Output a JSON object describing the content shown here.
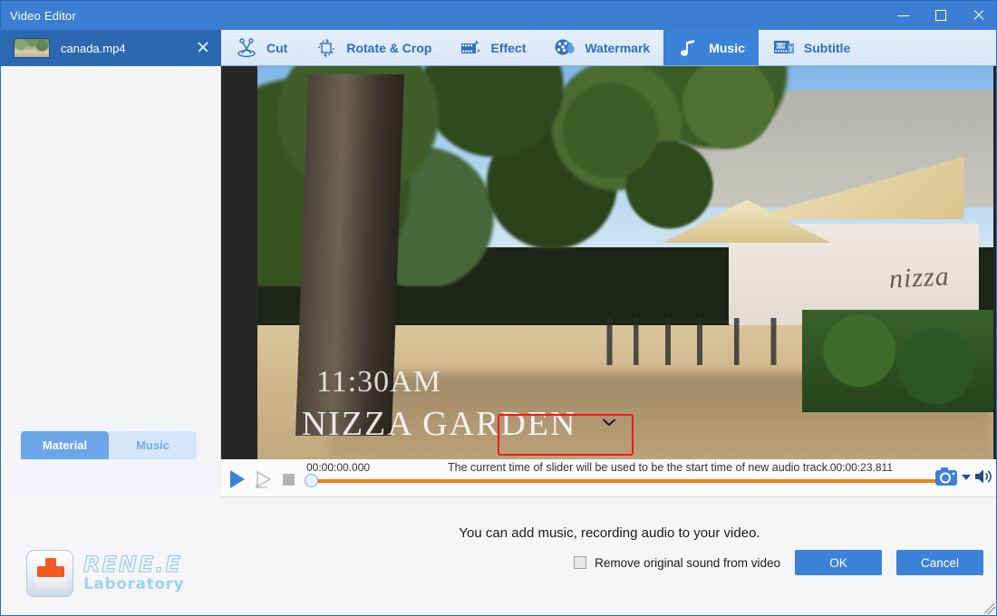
{
  "window": {
    "title": "Video Editor",
    "minimize_label": "Minimize",
    "maximize_label": "Maximize",
    "close_label": "Close"
  },
  "file_tab": {
    "name": "canada.mp4",
    "close_label": "Close file"
  },
  "toolbar": {
    "items": [
      {
        "label": "Cut",
        "icon": "scissors-icon",
        "active": false
      },
      {
        "label": "Rotate & Crop",
        "icon": "crop-rotate-icon",
        "active": false
      },
      {
        "label": "Effect",
        "icon": "film-sparkle-icon",
        "active": false
      },
      {
        "label": "Watermark",
        "icon": "watermark-icon",
        "active": false
      },
      {
        "label": "Music",
        "icon": "music-note-icon",
        "active": true
      },
      {
        "label": "Subtitle",
        "icon": "subtitle-icon",
        "active": false
      }
    ]
  },
  "left_panel": {
    "tabs": [
      {
        "label": "Material",
        "active": true
      },
      {
        "label": "Music",
        "active": false
      }
    ]
  },
  "video": {
    "overlay_time": "11:30AM",
    "overlay_place": "NIZZA GARDEN",
    "sign_text": "nizza"
  },
  "float_bar": {
    "buttons": [
      {
        "name": "add-music-button",
        "icon": "music-note-plus-icon"
      },
      {
        "name": "add-recording-button",
        "icon": "microphone-plus-icon"
      },
      {
        "name": "reset-audio-button",
        "icon": "refresh-icon"
      }
    ],
    "highlight_color": "#ee1c1c"
  },
  "transport": {
    "play_label": "Play",
    "step_label": "Step frame",
    "stop_label": "Stop",
    "start_time": "00:00:00.000",
    "end_time": "00:00:23.811",
    "hint": "The current time of slider will be used to be the start time of new audio track.",
    "progress_percent": 0,
    "track_color": "#f07c18",
    "snapshot_label": "Snapshot",
    "volume_label": "Volume"
  },
  "bottom": {
    "hint": "You can add music, recording audio to your video.",
    "checkbox_label": "Remove original sound from video",
    "checkbox_checked": false,
    "ok_label": "OK",
    "cancel_label": "Cancel"
  },
  "branding": {
    "name": "RENE.E",
    "subtitle": "Laboratory"
  },
  "colors": {
    "title_bar": "#3c7ed1",
    "accent": "#3c82d8",
    "toolbar_bg": "#dce9f7",
    "track": "#f07c18",
    "highlight": "#ee1c1c"
  }
}
